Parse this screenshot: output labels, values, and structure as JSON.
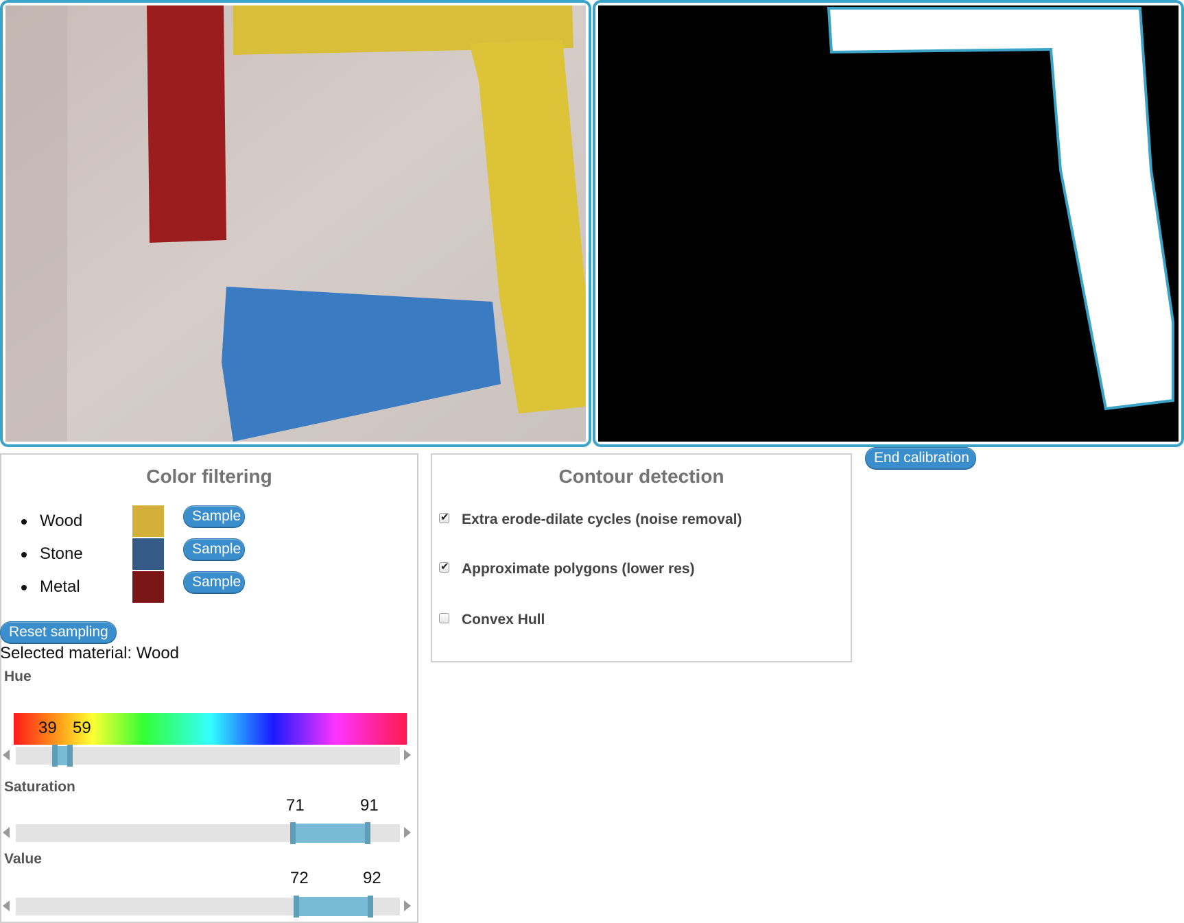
{
  "calibration": {
    "end_label": "End calibration"
  },
  "color_filtering": {
    "title": "Color filtering",
    "materials": [
      {
        "name": "Wood",
        "color": "#d2b03a",
        "button": "Sample"
      },
      {
        "name": "Stone",
        "color": "#345a85",
        "button": "Sample"
      },
      {
        "name": "Metal",
        "color": "#7a1616",
        "button": "Sample"
      }
    ],
    "reset_label": "Reset sampling",
    "selected_text": "Selected material: Wood",
    "hue": {
      "label": "Hue",
      "low": "39",
      "high": "59"
    },
    "saturation": {
      "label": "Saturation",
      "low": "71",
      "high": "91"
    },
    "value": {
      "label": "Value",
      "low": "72",
      "high": "92"
    }
  },
  "contour_detection": {
    "title": "Contour detection",
    "options": [
      {
        "label": "Extra erode-dilate cycles (noise removal)",
        "checked": true
      },
      {
        "label": "Approximate polygons (lower res)",
        "checked": true
      },
      {
        "label": "Convex Hull",
        "checked": false
      }
    ]
  },
  "colors": {
    "accent": "#3aa3c8",
    "button": "#3a8ecb",
    "paper_yellow": "#d9be3a",
    "paper_red": "#9a1c1c",
    "paper_blue": "#3b7bc2"
  }
}
